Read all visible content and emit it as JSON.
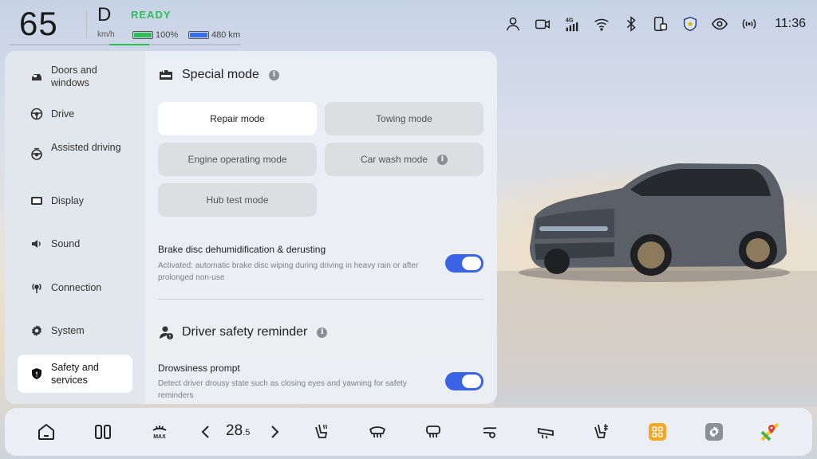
{
  "status": {
    "speed": "65",
    "gear": "D",
    "ready": "READY",
    "speed_unit": "km/h",
    "battery_percent": "100%",
    "battery_fill": 1.0,
    "range": "480 km",
    "range_fill": 1.0,
    "time": "11:36",
    "icons": [
      "user-icon",
      "dashcam-icon",
      "signal-4g-icon",
      "wifi-icon",
      "bluetooth-icon",
      "phone-link-icon",
      "shield-icon",
      "eye-icon",
      "wireless-icon"
    ],
    "network": "4G"
  },
  "sidebar": {
    "items": [
      {
        "label": "Doors and windows",
        "icon": "car-door-icon"
      },
      {
        "label": "Drive",
        "icon": "steering-wheel-icon"
      },
      {
        "label": "Assisted driving",
        "icon": "assisted-driving-icon"
      },
      {
        "label": "Display",
        "icon": "display-icon"
      },
      {
        "label": "Sound",
        "icon": "speaker-icon"
      },
      {
        "label": "Connection",
        "icon": "connection-icon"
      },
      {
        "label": "System",
        "icon": "gear-icon"
      },
      {
        "label": "Safety and services",
        "icon": "shield-icon",
        "active": true
      }
    ]
  },
  "special_mode": {
    "title": "Special mode",
    "modes": [
      {
        "label": "Repair mode",
        "selected": true
      },
      {
        "label": "Towing mode"
      },
      {
        "label": "Engine operating mode"
      },
      {
        "label": "Car wash mode",
        "info": true
      },
      {
        "label": "Hub test mode"
      }
    ],
    "brake": {
      "title": "Brake disc dehumidification & derusting",
      "desc": "Activated: automatic brake disc wiping during driving in heavy rain or after prolonged non-use",
      "enabled": true
    }
  },
  "driver_safety": {
    "title": "Driver safety reminder",
    "drowsiness": {
      "title": "Drowsiness prompt",
      "desc": "Detect driver drousy state such as closing eyes and yawning for safety reminders",
      "enabled": true
    }
  },
  "dock": {
    "temperature_main": "28",
    "temperature_decimal": ".5",
    "icons": [
      "home-icon",
      "split-view-icon",
      "max-defrost-icon",
      "temp-down-icon",
      "temp-up-icon",
      "seat-heat-icon",
      "front-defrost-icon",
      "rear-defrost-icon",
      "fan-icon",
      "steering-heat-icon",
      "seat-ventilation-icon",
      "apps-icon",
      "settings-icon",
      "maps-icon"
    ]
  },
  "colors": {
    "accent": "#3b63e6",
    "ready": "#2fbf59",
    "apps": "#f5a623"
  }
}
